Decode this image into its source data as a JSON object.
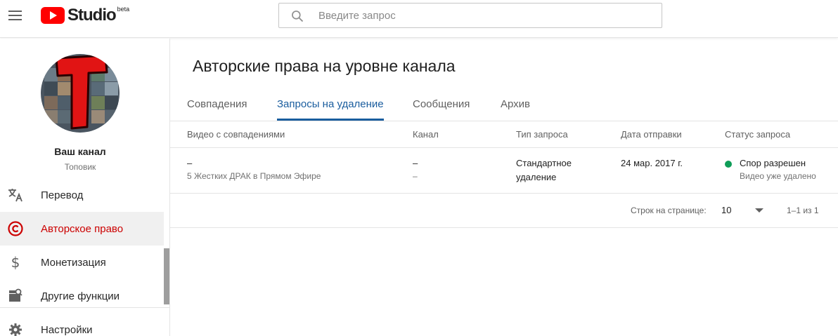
{
  "header": {
    "logo_text": "Studio",
    "logo_badge": "beta",
    "search_placeholder": "Введите запрос"
  },
  "sidebar": {
    "channel_name": "Ваш канал",
    "channel_subtitle": "Топовик",
    "items": [
      {
        "label": "Перевод",
        "icon": "translate-icon",
        "active": false
      },
      {
        "label": "Авторское право",
        "icon": "copyright-icon",
        "active": true
      },
      {
        "label": "Монетизация",
        "icon": "dollar-icon",
        "active": false
      },
      {
        "label": "Другие функции",
        "icon": "other-features-icon",
        "active": false
      },
      {
        "label": "Настройки",
        "icon": "gear-icon",
        "active": false
      }
    ]
  },
  "main": {
    "title": "Авторские права на уровне канала",
    "tabs": [
      {
        "label": "Совпадения",
        "active": false
      },
      {
        "label": "Запросы на удаление",
        "active": true
      },
      {
        "label": "Сообщения",
        "active": false
      },
      {
        "label": "Архив",
        "active": false
      }
    ],
    "table": {
      "headers": [
        "Видео с совпадениями",
        "Канал",
        "Тип запроса",
        "Дата отправки",
        "Статус запроса"
      ],
      "rows": [
        {
          "video_title": "–",
          "video_subtitle": "5 Жестких ДРАК в Прямом Эфире",
          "channel_line1": "–",
          "channel_line2": "–",
          "request_type_line1": "Стандартное",
          "request_type_line2": "удаление",
          "date": "24 мар. 2017 г.",
          "status": "Спор разрешен",
          "status_detail": "Видео уже удалено",
          "status_color": "#0f9d58"
        }
      ]
    },
    "pagination": {
      "rows_per_page_label": "Строк на странице:",
      "rows_per_page_value": "10",
      "range": "1–1 из 1"
    }
  },
  "colors": {
    "accent_red": "#cc0000",
    "tab_active": "#1a5d9e",
    "brand_red": "#ff0000"
  }
}
